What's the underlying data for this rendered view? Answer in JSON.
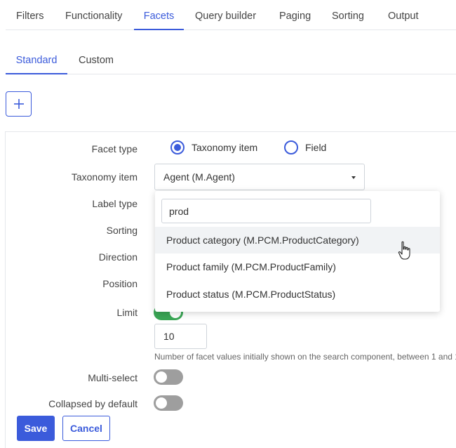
{
  "top_tabs": [
    {
      "label": "Filters"
    },
    {
      "label": "Functionality"
    },
    {
      "label": "Facets",
      "active": true
    },
    {
      "label": "Query builder"
    },
    {
      "label": "Paging"
    },
    {
      "label": "Sorting"
    },
    {
      "label": "Output"
    }
  ],
  "sub_tabs": [
    {
      "label": "Standard",
      "active": true
    },
    {
      "label": "Custom"
    }
  ],
  "add_button": {
    "icon": "plus-icon",
    "label": "+"
  },
  "form": {
    "facet_type": {
      "label": "Facet type",
      "options": [
        {
          "label": "Taxonomy item",
          "checked": true
        },
        {
          "label": "Field",
          "checked": false
        }
      ]
    },
    "taxonomy_item": {
      "label": "Taxonomy item",
      "value": "Agent (M.Agent)"
    },
    "label_type": {
      "label": "Label type"
    },
    "sorting": {
      "label": "Sorting"
    },
    "direction": {
      "label": "Direction"
    },
    "position": {
      "label": "Position"
    },
    "limit": {
      "label": "Limit",
      "enabled": true,
      "value": "10",
      "help": "Number of facet values initially shown on the search component, between 1 and 1"
    },
    "multi_select": {
      "label": "Multi-select",
      "enabled": false
    },
    "collapsed_by_default": {
      "label": "Collapsed by default",
      "enabled": false
    }
  },
  "dropdown": {
    "search_value": "prod",
    "options": [
      {
        "label": "Product category (M.PCM.ProductCategory)",
        "hovered": true
      },
      {
        "label": "Product family (M.PCM.ProductFamily)"
      },
      {
        "label": "Product status (M.PCM.ProductStatus)"
      }
    ]
  },
  "actions": {
    "save_label": "Save",
    "cancel_label": "Cancel"
  },
  "colors": {
    "accent": "#3b5bdb",
    "toggle_on": "#3aa655",
    "toggle_off": "#9e9e9e"
  }
}
